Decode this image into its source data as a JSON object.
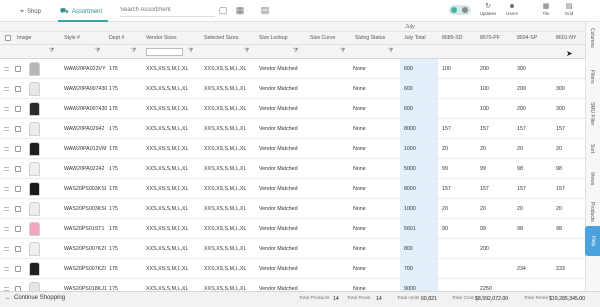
{
  "topbar": {
    "shop_label": "Shop",
    "assortment_label": "Assortment",
    "search_placeholder": "Search Assortment",
    "updates_label": "Updates",
    "users_label": "Users",
    "tile_label": "Tile",
    "grid_label": "Grid"
  },
  "group_header": "July",
  "columns": [
    "Image",
    "Style #",
    "Dept #",
    "Vendor Sizes",
    "Selected Sizes",
    "Size Lookup",
    "Size Curve",
    "Sizing Status",
    "July Total",
    "8689-SD",
    "8670-PF",
    "8694-SP",
    "8601-NY"
  ],
  "rows": [
    {
      "style": "WAW20PA023VY",
      "dept": "175",
      "vsizes": "XXS,XS,S,M,L,XL",
      "ssizes": "XXS,XS,S,M,L,XL",
      "lookup": "Vendor Matched",
      "curve": "",
      "status": "None",
      "total": "600",
      "s1": "100",
      "s2": "200",
      "s3": "300",
      "s4": "",
      "color": "#b7b7b7"
    },
    {
      "style": "WAW20PA007430",
      "dept": "175",
      "vsizes": "XXS,XS,S,M,L,XL",
      "ssizes": "XXS,XS,S,M,L,XL",
      "lookup": "Vendor Matched",
      "curve": "",
      "status": "None",
      "total": "600",
      "s1": "",
      "s2": "100",
      "s3": "200",
      "s4": "300",
      "color": "#e8e8e8"
    },
    {
      "style": "WAW20PA007430",
      "dept": "175",
      "vsizes": "XXS,XS,S,M,L,XL",
      "ssizes": "XXS,XS,S,M,L,XL",
      "lookup": "Vendor Matched",
      "curve": "",
      "status": "None",
      "total": "600",
      "s1": "",
      "s2": "100",
      "s3": "200",
      "s4": "300",
      "color": "#2b2b2b"
    },
    {
      "style": "WAW20PA02942",
      "dept": "175",
      "vsizes": "XXS,XS,S,M,L,XL",
      "ssizes": "XXS,XS,S,M,L,XL",
      "lookup": "Vendor Matched",
      "curve": "",
      "status": "None",
      "total": "8000",
      "s1": "157",
      "s2": "157",
      "s3": "157",
      "s4": "157",
      "color": "#ececec"
    },
    {
      "style": "WAW20PA012VM",
      "dept": "175",
      "vsizes": "XXS,XS,S,M,L,XL",
      "ssizes": "XXS,XS,S,M,L,XL",
      "lookup": "Vendor Matched",
      "curve": "",
      "status": "None",
      "total": "1000",
      "s1": "20",
      "s2": "20",
      "s3": "20",
      "s4": "20",
      "color": "#1f1f1f"
    },
    {
      "style": "WAW20PA02242",
      "dept": "175",
      "vsizes": "XXS,XS,S,M,L,XL",
      "ssizes": "XXS,XS,S,M,L,XL",
      "lookup": "Vendor Matched",
      "curve": "",
      "status": "None",
      "total": "5000",
      "s1": "99",
      "s2": "99",
      "s3": "98",
      "s4": "98",
      "color": "#efefef"
    },
    {
      "style": "WAS20PS003KSI",
      "dept": "175",
      "vsizes": "XXS,XS,S,M,L,XL",
      "ssizes": "XXS,XS,S,M,L,XL",
      "lookup": "Vendor Matched",
      "curve": "",
      "status": "None",
      "total": "8000",
      "s1": "157",
      "s2": "157",
      "s3": "157",
      "s4": "157",
      "color": "#1a1a1a"
    },
    {
      "style": "WAS20PS003KSI",
      "dept": "175",
      "vsizes": "XXS,XS,S,M,L,XL",
      "ssizes": "XXS,XS,S,M,L,XL",
      "lookup": "Vendor Matched",
      "curve": "",
      "status": "None",
      "total": "1000",
      "s1": "20",
      "s2": "20",
      "s3": "20",
      "s4": "20",
      "color": "#ededed"
    },
    {
      "style": "WAS20PS01ST1",
      "dept": "175",
      "vsizes": "XXS,XS,S,M,L,XL",
      "ssizes": "XXS,XS,S,M,L,XL",
      "lookup": "Vendor Matched",
      "curve": "",
      "status": "None",
      "total": "5601",
      "s1": "90",
      "s2": "99",
      "s3": "98",
      "s4": "98",
      "color": "#f2a7bb"
    },
    {
      "style": "WAS20PS007KZI",
      "dept": "175",
      "vsizes": "XXS,XS,S,M,L,XL",
      "ssizes": "XXS,XS,S,M,L,XL",
      "lookup": "Vendor Matched",
      "curve": "",
      "status": "None",
      "total": "800",
      "s1": "",
      "s2": "200",
      "s3": "",
      "s4": "",
      "color": "#efefef"
    },
    {
      "style": "WAS20PS007KZI",
      "dept": "175",
      "vsizes": "XXS,XS,S,M,L,XL",
      "ssizes": "XXS,XS,S,M,L,XL",
      "lookup": "Vendor Matched",
      "curve": "",
      "status": "None",
      "total": "700",
      "s1": "",
      "s2": "",
      "s3": "234",
      "s4": "233",
      "color": "#202020"
    },
    {
      "style": "WAS20PS018KJ1",
      "dept": "175",
      "vsizes": "XXS,XS,S,M,L,XL",
      "ssizes": "XXS,XS,S,M,L,XL",
      "lookup": "Vendor Matched",
      "curve": "",
      "status": "None",
      "total": "9000",
      "s1": "",
      "s2": "2250",
      "s3": "",
      "s4": "",
      "color": "#e6e6e6"
    }
  ],
  "side_tabs": [
    "Columns",
    "Filters",
    "SMU Filter",
    "Sort",
    "Views",
    "Products"
  ],
  "help_label": "Help",
  "footer": {
    "continue_label": "Continue Shopping",
    "total_products_label": "Total Products",
    "total_products": "14",
    "total_rows_label": "Total Rows",
    "total_rows": "14",
    "total_units_label": "Total Units",
    "total_units": "60,821",
    "total_cost_label": "Total Cost",
    "total_cost": "$8,592,072.00",
    "total_retail_label": "Total Retail",
    "total_retail": "$19,285,345.00"
  }
}
